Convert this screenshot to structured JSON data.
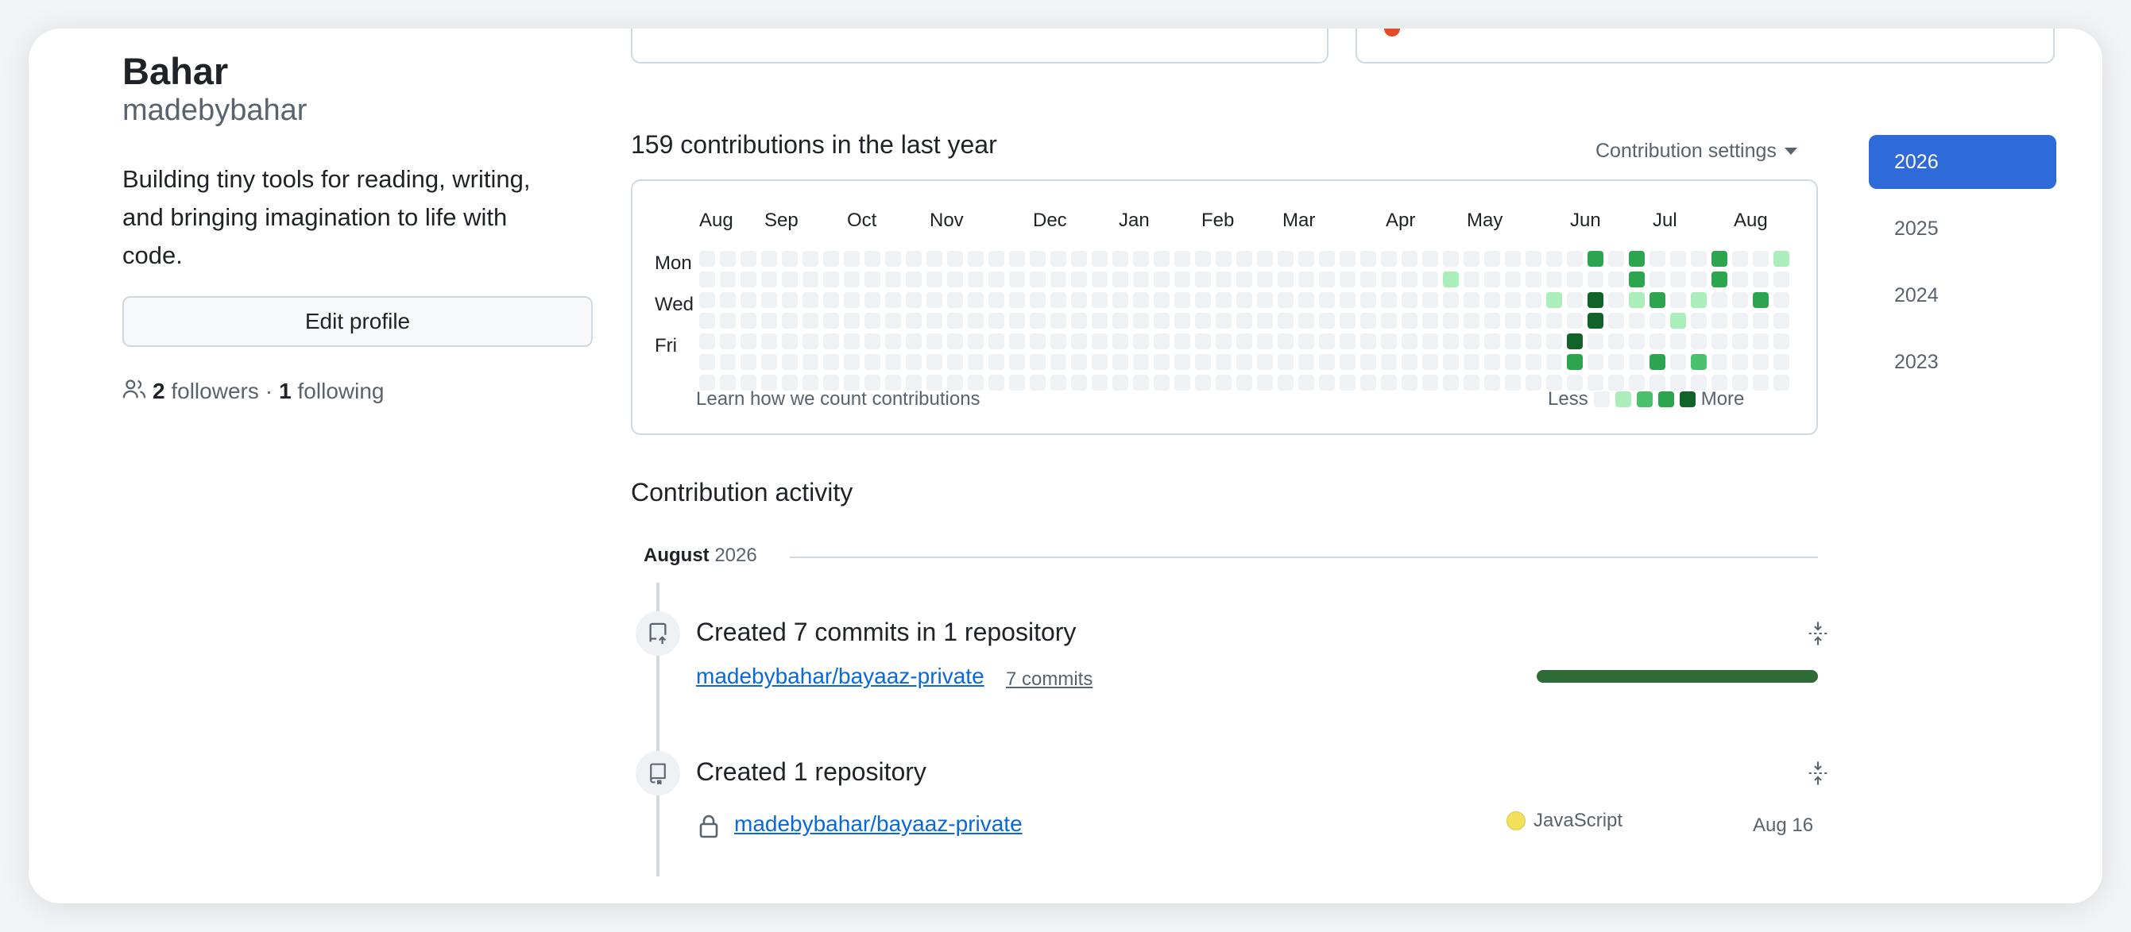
{
  "profile": {
    "name": "Bahar",
    "login": "madebybahar",
    "bio": "Building tiny tools for reading, writing, and bringing imagination to life with code.",
    "edit_button": "Edit profile",
    "followers_count": "2",
    "followers_label": "followers",
    "separator": "·",
    "following_count": "1",
    "following_label": "following"
  },
  "contributions": {
    "title": "159 contributions in the last year",
    "settings_label": "Contribution settings",
    "months": [
      "Aug",
      "Sep",
      "Oct",
      "Nov",
      "Dec",
      "Jan",
      "Feb",
      "Mar",
      "Apr",
      "May",
      "Jun",
      "Jul",
      "Aug"
    ],
    "days": [
      "Mon",
      "Wed",
      "Fri"
    ],
    "learn_link": "Learn how we count contributions",
    "legend_less": "Less",
    "legend_more": "More",
    "colors": [
      "#eff2f5",
      "#aceebb",
      "#4ac26b",
      "#2da44e",
      "#116329"
    ],
    "active_cells": [
      {
        "week": 43,
        "day": 0,
        "level": 3
      },
      {
        "week": 45,
        "day": 0,
        "level": 3
      },
      {
        "week": 49,
        "day": 0,
        "level": 3
      },
      {
        "week": 52,
        "day": 0,
        "level": 1
      },
      {
        "week": 36,
        "day": 1,
        "level": 1
      },
      {
        "week": 45,
        "day": 1,
        "level": 3
      },
      {
        "week": 49,
        "day": 1,
        "level": 3
      },
      {
        "week": 41,
        "day": 2,
        "level": 1
      },
      {
        "week": 43,
        "day": 2,
        "level": 4
      },
      {
        "week": 45,
        "day": 2,
        "level": 1
      },
      {
        "week": 46,
        "day": 2,
        "level": 3
      },
      {
        "week": 48,
        "day": 2,
        "level": 1
      },
      {
        "week": 51,
        "day": 2,
        "level": 3
      },
      {
        "week": 43,
        "day": 3,
        "level": 4
      },
      {
        "week": 47,
        "day": 3,
        "level": 1
      },
      {
        "week": 42,
        "day": 4,
        "level": 4
      },
      {
        "week": 42,
        "day": 5,
        "level": 3
      },
      {
        "week": 46,
        "day": 5,
        "level": 3
      },
      {
        "week": 48,
        "day": 5,
        "level": 2
      }
    ]
  },
  "years": [
    {
      "label": "2026",
      "active": true
    },
    {
      "label": "2025",
      "active": false
    },
    {
      "label": "2024",
      "active": false
    },
    {
      "label": "2023",
      "active": false
    }
  ],
  "activity": {
    "title": "Contribution activity",
    "month_label": "August",
    "month_year": "2026",
    "entries": [
      {
        "title": "Created 7 commits in 1 repository",
        "repo": "madebybahar/bayaaz-private",
        "commits": "7 commits",
        "bar_fraction": 1.0,
        "icon": "repo-push-icon"
      },
      {
        "title": "Created 1 repository",
        "repo": "madebybahar/bayaaz-private",
        "language": "JavaScript",
        "language_color": "#f1e05a",
        "date": "Aug 16",
        "icon": "repo-icon"
      }
    ]
  }
}
